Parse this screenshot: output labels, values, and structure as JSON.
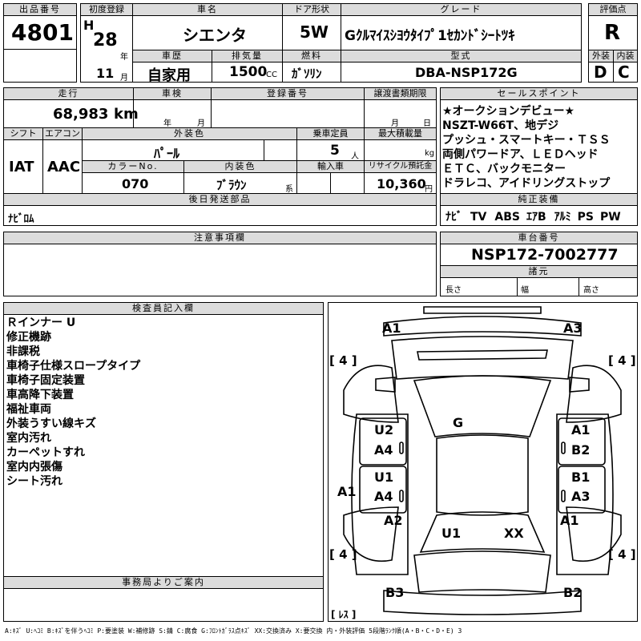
{
  "lot": {
    "label": "出品番号",
    "value": "4801"
  },
  "first_reg": {
    "label": "初度登録",
    "era": "H",
    "year": "28",
    "year_unit": "年",
    "month": "11",
    "month_unit": "月"
  },
  "car_name": {
    "label": "車名",
    "value": "シエンタ"
  },
  "door": {
    "label": "ドア形状",
    "value": "5W"
  },
  "grade": {
    "label": "グレード",
    "value": "Gｸﾙﾏｲｽｼﾖｳﾀｲﾌﾟ1ｾｶﾝﾄﾞｼｰﾄﾂｷ"
  },
  "score": {
    "label": "評価点",
    "value": "R",
    "ext_label": "外装",
    "ext_value": "D",
    "int_label": "内装",
    "int_value": "C"
  },
  "history": {
    "label": "車歴",
    "value": "自家用"
  },
  "displacement": {
    "label": "排気量",
    "value": "1500",
    "unit": "CC"
  },
  "fuel": {
    "label": "燃料",
    "value": "ｶﾞｿﾘﾝ"
  },
  "model": {
    "label": "型式",
    "value": "DBA-NSP172G"
  },
  "mileage": {
    "label": "走行",
    "value": "68,983",
    "unit": "km"
  },
  "inspection": {
    "label": "車検",
    "year_unit": "年",
    "month_unit": "月"
  },
  "reg_no": {
    "label": "登録番号"
  },
  "transfer": {
    "label": "譲渡書類期限",
    "month_unit": "月",
    "day_unit": "日"
  },
  "shift": {
    "label": "シフト",
    "value": "IAT"
  },
  "ac": {
    "label": "エアコン",
    "value": "AAC"
  },
  "color": {
    "label": "外装色",
    "value": "ﾊﾟｰﾙ"
  },
  "capacity": {
    "label": "乗車定員",
    "value": "5",
    "unit": "人"
  },
  "max_load": {
    "label": "最大積載量",
    "unit": "kg"
  },
  "color_no": {
    "label": "カラーNo.",
    "value": "070"
  },
  "interior": {
    "label": "内装色",
    "value": "ﾌﾞﾗｳﾝ",
    "unit": "系"
  },
  "import": {
    "label": "輸入車"
  },
  "recycle": {
    "label": "リサイクル預託金",
    "value": "10,360",
    "unit": "円"
  },
  "later_parts": {
    "label": "後日発送部品",
    "value": "ﾅﾋﾞﾛﾑ"
  },
  "sales_points": {
    "label": "セールスポイント",
    "lines": [
      "★オークションデビュー★",
      "NSZT-W66T、地デジ",
      "プッシュ・スマートキー・ＴＳＳ",
      "両側パワードア、ＬＥＤヘッド",
      "ＥＴＣ、バックモニター",
      "ドラレコ、アイドリングストップ"
    ]
  },
  "equipment": {
    "label": "純正装備",
    "items": [
      "ﾅﾋﾞ",
      "TV",
      "ABS",
      "ｴｱB",
      "ｱﾙﾐ",
      "PS",
      "PW"
    ]
  },
  "notes": {
    "label": "注意事項欄"
  },
  "chassis": {
    "label": "車台番号",
    "value": "NSP172-7002777"
  },
  "specs": {
    "label": "諸元",
    "length": "長さ",
    "width": "幅",
    "height": "高さ"
  },
  "inspector": {
    "label": "検査員記入欄",
    "lines": [
      "Ｒインナー U",
      "修正機跡",
      "非課税",
      "車椅子仕様スロープタイプ",
      "車椅子固定装置",
      "車高降下装置",
      "福祉車両",
      "外装うすい線キズ",
      "室内汚れ",
      "カーペットすれ",
      "室内内張傷",
      "シート汚れ"
    ]
  },
  "office": {
    "label": "事務局よりご案内"
  },
  "diagram": {
    "marks": [
      "A1",
      "A3",
      "U2",
      "A4",
      "A1",
      "B2",
      "G",
      "U1",
      "A4",
      "B1",
      "A3",
      "A1",
      "A2",
      "A1",
      "U1",
      "XX",
      "B3",
      "B2"
    ],
    "tires": [
      "[ 4 ]",
      "[ 4 ]",
      "[ 4 ]",
      "[ 4 ]"
    ],
    "spare": "[ ﾚｽ ]"
  },
  "legend": "A:ｷｽﾞ U:ﾍｺﾐ B:ｷｽﾞを伴うﾍｺﾐ P:要塗装 W:補修跡 S:錆 C:腐食 G:ﾌﾛﾝﾄｶﾞﾗｽ点ｷｽﾞ XX:交換済み X:要交換 内・外装評価 5段階ﾗﾝｸ順(A・B・C・D・E) 3"
}
